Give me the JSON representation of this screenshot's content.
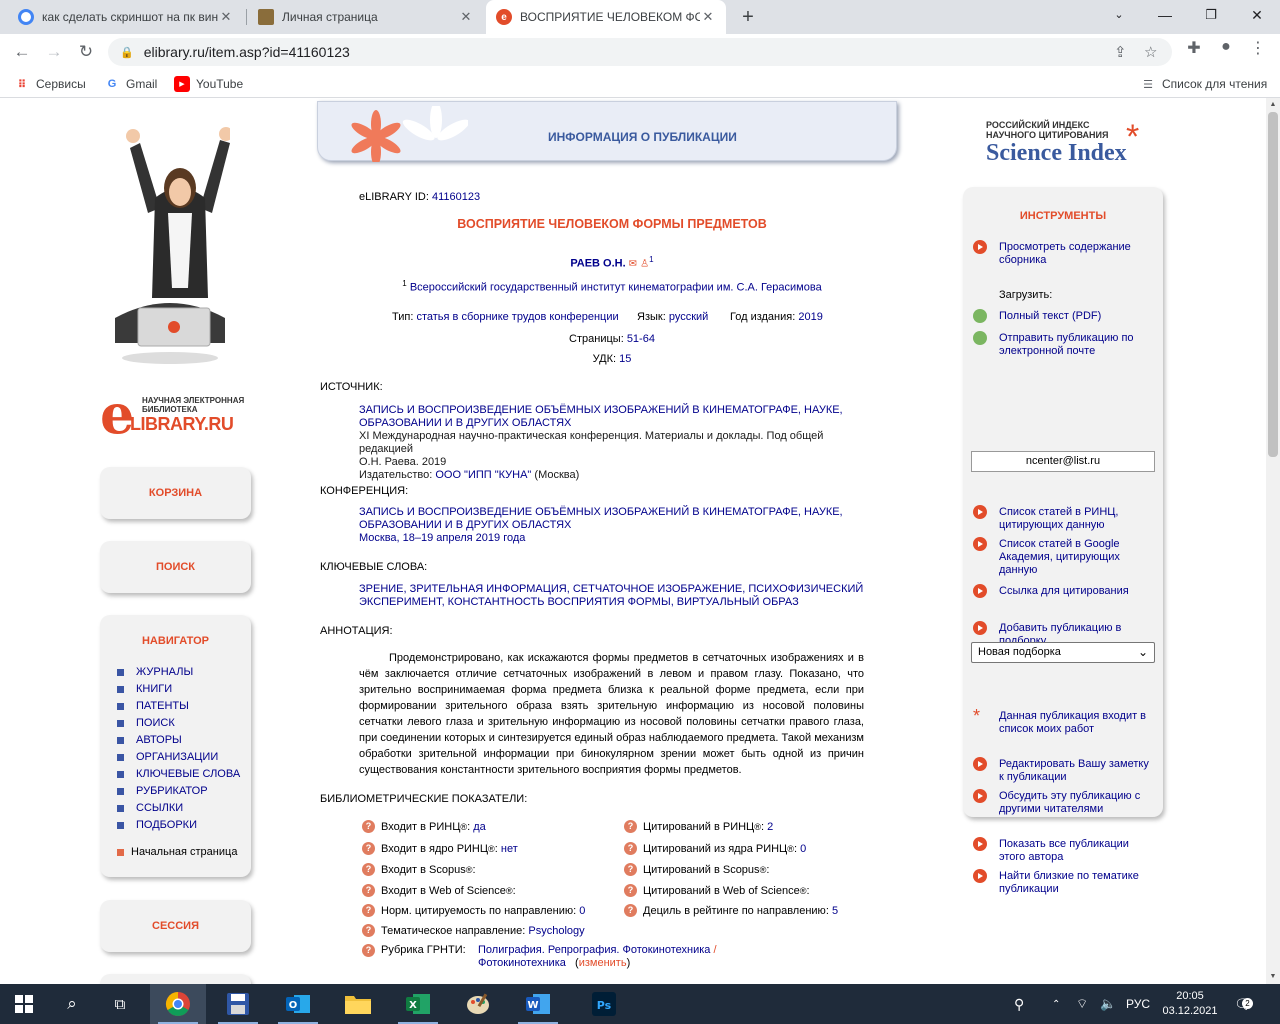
{
  "browser": {
    "tabs": [
      {
        "title": "как сделать скриншот на пк вин"
      },
      {
        "title": "Личная страница"
      },
      {
        "title": "ВОСПРИЯТИЕ ЧЕЛОВЕКОМ ФОРМ"
      }
    ],
    "url": "elibrary.ru/item.asp?id=41160123",
    "bookmarks": [
      {
        "label": "Сервисы"
      },
      {
        "label": "Gmail"
      },
      {
        "label": "YouTube"
      }
    ],
    "reading_list": "Список для чтения"
  },
  "left": {
    "logo_small": "НАУЧНАЯ ЭЛЕКТРОННАЯ БИБЛИОТЕКА",
    "logo_name": "LIBRARY.RU",
    "cart": "КОРЗИНА",
    "search": "ПОИСК",
    "navigator_title": "НАВИГАТОР",
    "nav": [
      "ЖУРНАЛЫ",
      "КНИГИ",
      "ПАТЕНТЫ",
      "ПОИСК",
      "АВТОРЫ",
      "ОРГАНИЗАЦИИ",
      "КЛЮЧЕВЫЕ СЛОВА",
      "РУБРИКАТОР",
      "ССЫЛКИ",
      "ПОДБОРКИ"
    ],
    "home": "Начальная страница",
    "session": "СЕССИЯ"
  },
  "pub": {
    "header": "ИНФОРМАЦИЯ О ПУБЛИКАЦИИ",
    "id_label": "eLIBRARY ID:",
    "id": "41160123",
    "title": "ВОСПРИЯТИЕ ЧЕЛОВЕКОМ ФОРМЫ ПРЕДМЕТОВ",
    "author": "РАЕВ О.Н.",
    "author_sup": "1",
    "aff_sup": "1",
    "affiliation": "Всероссийский государственный институт кинематографии им. С.А. Герасимова",
    "type_label": "Тип:",
    "type": "статья в сборнике трудов конференции",
    "lang_label": "Язык:",
    "lang": "русский",
    "year_label": "Год издания:",
    "year": "2019",
    "pages_label": "Страницы:",
    "pages": "51-64",
    "udk_label": "УДК:",
    "udk": "15",
    "source_h": "ИСТОЧНИК:",
    "source_link_1": "ЗАПИСЬ И ВОСПРОИЗВЕДЕНИЕ ОБЪЁМНЫХ ИЗОБРАЖЕНИЙ В КИНЕМАТОГРАФЕ, НАУКЕ,",
    "source_link_2": "ОБРАЗОВАНИИ И В ДРУГИХ ОБЛАСТЯХ",
    "source_text_1": "XI Международная научно-практическая конференция. Материалы и доклады. Под общей редакцией",
    "source_text_2": "О.Н. Раева. 2019",
    "publisher_label": "Издательство:",
    "publisher": "ООО \"ИПП \"КУНА\"",
    "publisher_city": "(Москва)",
    "conf_h": "КОНФЕРЕНЦИЯ:",
    "conf_link_1": "ЗАПИСЬ И ВОСПРОИЗВЕДЕНИЕ ОБЪЁМНЫХ ИЗОБРАЖЕНИЙ В КИНЕМАТОГРАФЕ, НАУКЕ,",
    "conf_link_2": "ОБРАЗОВАНИИ И В ДРУГИХ ОБЛАСТЯХ",
    "conf_place": "Москва, 18–19 апреля 2019 года",
    "kw_h": "КЛЮЧЕВЫЕ СЛОВА:",
    "kw_1": "ЗРЕНИЕ, ЗРИТЕЛЬНАЯ ИНФОРМАЦИЯ, СЕТЧАТОЧНОЕ ИЗОБРАЖЕНИЕ, ПСИХОФИЗИЧЕСКИЙ",
    "kw_2": "ЭКСПЕРИМЕНТ, КОНСТАНТНОСТЬ ВОСПРИЯТИЯ ФОРМЫ, ВИРТУАЛЬНЫЙ ОБРАЗ",
    "abstract_h": "АННОТАЦИЯ:",
    "abstract": "Продемонстрировано, как искажаются формы предметов в сетчаточных изображениях и в чём заключается отличие сетчаточных изображений в левом и правом глазу. Показано, что зрительно воспринимаемая форма предмета близка к реальной форме предмета, если при формировании зрительного образа взять зрительную информацию из носовой половины сетчатки левого глаза и зрительную информацию из носовой половины сетчатки правого глаза, при соединении которых и синтезируется единый образ наблюдаемого предмета. Такой механизм обработки зрительной информации при бинокулярном зрении может быть одной из причин существования константности зрительного восприятия формы предметов.",
    "bib_h": "БИБЛИОМЕТРИЧЕСКИЕ ПОКАЗАТЕЛИ:",
    "bib_left": [
      {
        "label": "Входит в РИНЦ",
        "sup": "®",
        "sep": ":",
        "value": "да"
      },
      {
        "label": "Входит в ядро РИНЦ",
        "sup": "®",
        "sep": ":",
        "value": "нет"
      },
      {
        "label": "Входит в Scopus",
        "sup": "®",
        "sep": ":",
        "value": ""
      },
      {
        "label": "Входит в Web of Science",
        "sup": "®",
        "sep": ":",
        "value": ""
      },
      {
        "label": "Норм. цитируемость по направлению",
        "sup": "",
        "sep": ":",
        "value": "0"
      },
      {
        "label": "Тематическое направление",
        "sup": "",
        "sep": ":",
        "value": "Psychology"
      }
    ],
    "bib_right": [
      {
        "label": "Цитирований в РИНЦ",
        "sup": "®",
        "sep": ":",
        "value": "2"
      },
      {
        "label": "Цитирований из ядра РИНЦ",
        "sup": "®",
        "sep": ":",
        "value": "0"
      },
      {
        "label": "Цитирований в Scopus",
        "sup": "®",
        "sep": ":",
        "value": ""
      },
      {
        "label": "Цитирований в Web of Science",
        "sup": "®",
        "sep": ":",
        "value": ""
      },
      {
        "label": "Дециль в рейтинге по направлению",
        "sup": "",
        "sep": ":",
        "value": "5"
      }
    ],
    "grnti_label": "Рубрика ГРНТИ:",
    "grnti_1": "Полиграфия. Репрография. Фотокинотехника",
    "grnti_slash": "/",
    "grnti_2": "Фотокинотехника",
    "grnti_change_open": "(",
    "grnti_change": "изменить",
    "grnti_change_close": ")"
  },
  "right": {
    "sci_small_1": "РОССИЙСКИЙ ИНДЕКС",
    "sci_small_2": "НАУЧНОГО ЦИТИРОВАНИЯ",
    "sci_name": "Science Index",
    "tools_title": "ИНСТРУМЕНТЫ",
    "view_contents": "Просмотреть содержание сборника",
    "download_label": "Загрузить:",
    "full_text": "Полный текст (PDF)",
    "send_email": "Отправить публикацию по электронной почте",
    "email": "ncenter@list.ru",
    "rinc_list": "Список статей в РИНЦ, цитирующих данную",
    "google_list": "Список статей в Google Академия, цитирующих данную",
    "cite_link": "Ссылка для цитирования",
    "add_to_set": "Добавить публикацию в подборку",
    "set_value": "Новая подборка",
    "in_my_works": "Данная публикация входит в список моих работ",
    "edit_note": "Редактировать Вашу заметку к публикации",
    "discuss": "Обсудить эту публикацию с другими читателями",
    "show_all": "Показать все публикации этого автора",
    "find_similar": "Найти близкие по тематике публикации"
  },
  "taskbar": {
    "lang": "РУС",
    "time": "20:05",
    "date": "03.12.2021",
    "notif_count": "2"
  }
}
